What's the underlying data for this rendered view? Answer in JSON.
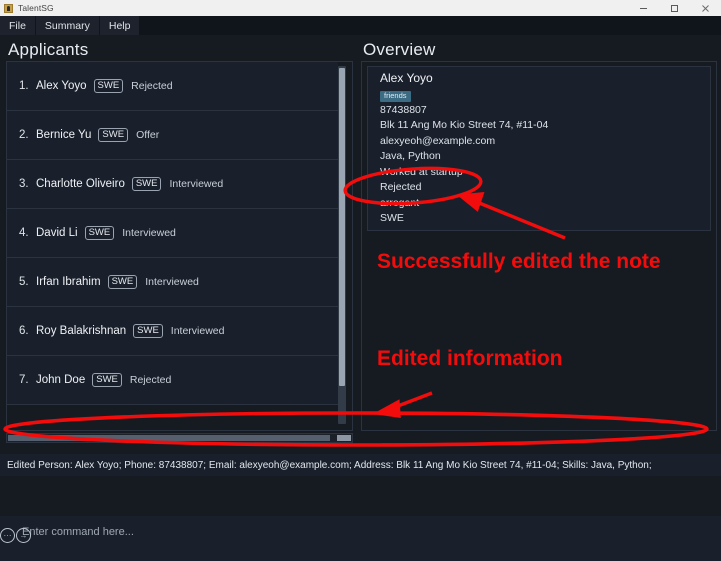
{
  "window": {
    "title": "TalentSG",
    "icon": "app-icon",
    "controls": [
      {
        "name": "minimize-button",
        "glyph": "minimize-icon"
      },
      {
        "name": "maximize-button",
        "glyph": "maximize-icon"
      },
      {
        "name": "close-button",
        "glyph": "close-icon"
      }
    ]
  },
  "menubar": {
    "items": [
      {
        "label": "File"
      },
      {
        "label": "Summary"
      },
      {
        "label": "Help"
      }
    ]
  },
  "panels": {
    "left_title": "Applicants",
    "right_title": "Overview"
  },
  "applicants": [
    {
      "index": "1.",
      "name": "Alex Yoyo",
      "role": "SWE",
      "status": "Rejected"
    },
    {
      "index": "2.",
      "name": "Bernice Yu",
      "role": "SWE",
      "status": "Offer"
    },
    {
      "index": "3.",
      "name": "Charlotte Oliveiro",
      "role": "SWE",
      "status": "Interviewed"
    },
    {
      "index": "4.",
      "name": "David Li",
      "role": "SWE",
      "status": "Interviewed"
    },
    {
      "index": "5.",
      "name": "Irfan Ibrahim",
      "role": "SWE",
      "status": "Interviewed"
    },
    {
      "index": "6.",
      "name": "Roy Balakrishnan",
      "role": "SWE",
      "status": "Interviewed"
    },
    {
      "index": "7.",
      "name": "John Doe",
      "role": "SWE",
      "status": "Rejected"
    }
  ],
  "overview": {
    "name": "Alex Yoyo",
    "tag": "friends",
    "lines": [
      "87438807",
      "Blk 11 Ang Mo Kio Street 74, #11-04",
      "alexyeoh@example.com",
      "Java, Python",
      "Worked at startup",
      "Rejected",
      "arrogant",
      "SWE"
    ]
  },
  "statusbar": {
    "text": "Edited Person: Alex Yoyo; Phone: 87438807; Email: alexyeoh@example.com; Address: Blk 11 Ang Mo Kio Street 74, #11-04; Skills: Java, Python;"
  },
  "command": {
    "placeholder": "Enter command here...",
    "icons": [
      {
        "name": "face-icon",
        "glyph": "···"
      },
      {
        "name": "arrow-right-icon",
        "glyph": "→"
      }
    ]
  },
  "annotations": {
    "note_label": "Successfully edited the note",
    "info_label": "Edited information",
    "color": "#f30c0c"
  }
}
